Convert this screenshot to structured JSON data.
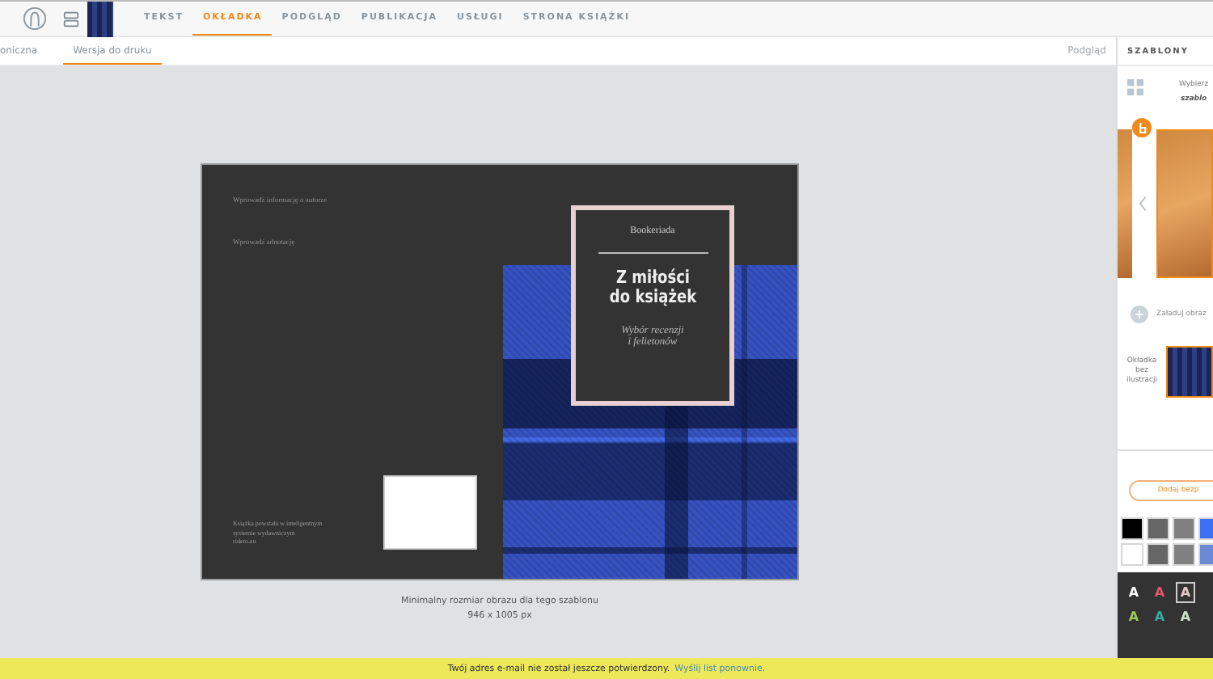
{
  "nav_tabs": [
    {
      "label": "TEKST",
      "selected": false
    },
    {
      "label": "OKŁADKA",
      "selected": true
    },
    {
      "label": "PODGLĄD",
      "selected": false
    },
    {
      "label": "PUBLIKACJA",
      "selected": false
    },
    {
      "label": "USŁUGI",
      "selected": false
    },
    {
      "label": "STRONA KSIĄŻKI",
      "selected": false
    }
  ],
  "sub_tabs": [
    {
      "label": "oniczna",
      "selected": false
    },
    {
      "label": "Wersja do druku",
      "selected": true
    }
  ],
  "preview_link": "Podgląd",
  "cover": {
    "author_info": "Wprowadź informację o autorze",
    "annotation": "Wprowadź adnotację",
    "publisher_note": [
      "Książka powstała w inteligentnym",
      "systemie wydawniczym",
      "ridero.eu"
    ],
    "series": "Bookeriada",
    "title": [
      "Z miłości",
      "do książek"
    ],
    "subtitle": [
      "Wybór recenzji",
      "i felietonów"
    ]
  },
  "image_hint": [
    "Minimalny rozmiar obrazu dla tego szablonu",
    "946 x 1005 px"
  ],
  "sidebar": {
    "title": "SZABLONY",
    "choose": [
      "Wybierz",
      "szablo"
    ],
    "upload": "Załaduj obraz",
    "no_illustration": [
      "Okładka",
      "bez",
      "ilustracji"
    ],
    "add_button": "Dodaj bezp",
    "swatches": [
      {
        "color": "#000000",
        "selected": false
      },
      {
        "color": "#666666",
        "selected": false
      },
      {
        "color": "#808080",
        "selected": false
      },
      {
        "color": "#3d6ef5",
        "selected": false
      },
      {
        "color": "#ffffff",
        "selected": false
      },
      {
        "color": "#666666",
        "selected": false
      },
      {
        "color": "#808080",
        "selected": false
      },
      {
        "color": "#6a8ad6",
        "selected": false
      }
    ],
    "font_colors": [
      {
        "label": "A",
        "color": "#ffffff",
        "selected": false
      },
      {
        "label": "A",
        "color": "#e05a6a",
        "selected": false
      },
      {
        "label": "A",
        "color": "#e8c8cc",
        "selected": true
      },
      {
        "label": "A",
        "color": "#9ccc5a",
        "selected": false
      },
      {
        "label": "A",
        "color": "#3aa8a8",
        "selected": false
      },
      {
        "label": "A",
        "color": "#cfe0d0",
        "selected": false
      }
    ]
  },
  "notice": {
    "text": "Twój adres e-mail nie został jeszcze potwierdzony.",
    "link": "Wyślij list ponownie."
  }
}
